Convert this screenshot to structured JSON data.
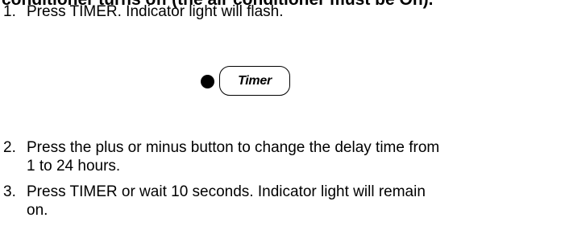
{
  "heading_partial": "conditioner turns off (the air conditioner must be On).",
  "steps": [
    {
      "number": "1.",
      "lines": [
        "Press TIMER. Indicator light will flash."
      ]
    },
    {
      "number": "2.",
      "lines": [
        "Press the plus or minus button to change the delay time from",
        "1 to 24 hours."
      ]
    },
    {
      "number": "3.",
      "lines": [
        "Press TIMER or wait 10 seconds. Indicator light will remain",
        "on."
      ]
    }
  ],
  "timer_button": {
    "label": "Timer"
  },
  "icons": {
    "indicator": "indicator-light-icon"
  },
  "colors": {
    "text": "#000000",
    "background": "#ffffff"
  }
}
